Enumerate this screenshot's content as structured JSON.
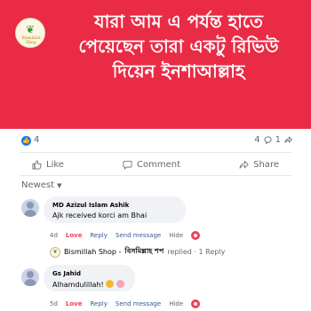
{
  "banner": {
    "lines": [
      "যারা আম এ পর্যন্ত হাতে",
      "পেয়েছেন তারা একটু রিভিউ",
      "দিয়েন ইনশাআল্লাহ"
    ],
    "logo_text": "Bismillah Shop"
  },
  "stats": {
    "like_count": "4",
    "comment_count": "4",
    "share_count": "1"
  },
  "actions": {
    "like": "Like",
    "comment": "Comment",
    "share": "Share"
  },
  "sort_label": "Newest",
  "comments": [
    {
      "name": "MD Azizul Islam Ashik",
      "text": "Ajk received korci am Bhai",
      "time": "4d",
      "love": "Love",
      "reply": "Reply",
      "send": "Send message",
      "hide": "Hide"
    },
    {
      "name": "Gs Jahid",
      "text": "Alhamdulillah!",
      "time": "5d",
      "love": "Love",
      "reply": "Reply",
      "send": "Send message",
      "hide": "Hide"
    }
  ],
  "reply_summary": {
    "shop_name": "Bismillah Shop -",
    "shop_name_bn": "বিসমিল্লাহ শপ",
    "suffix": "replied · 1 Reply"
  },
  "colors": {
    "banner_bg": "#ea2b45",
    "accent": "#1877f2",
    "love": "#f33e58"
  }
}
